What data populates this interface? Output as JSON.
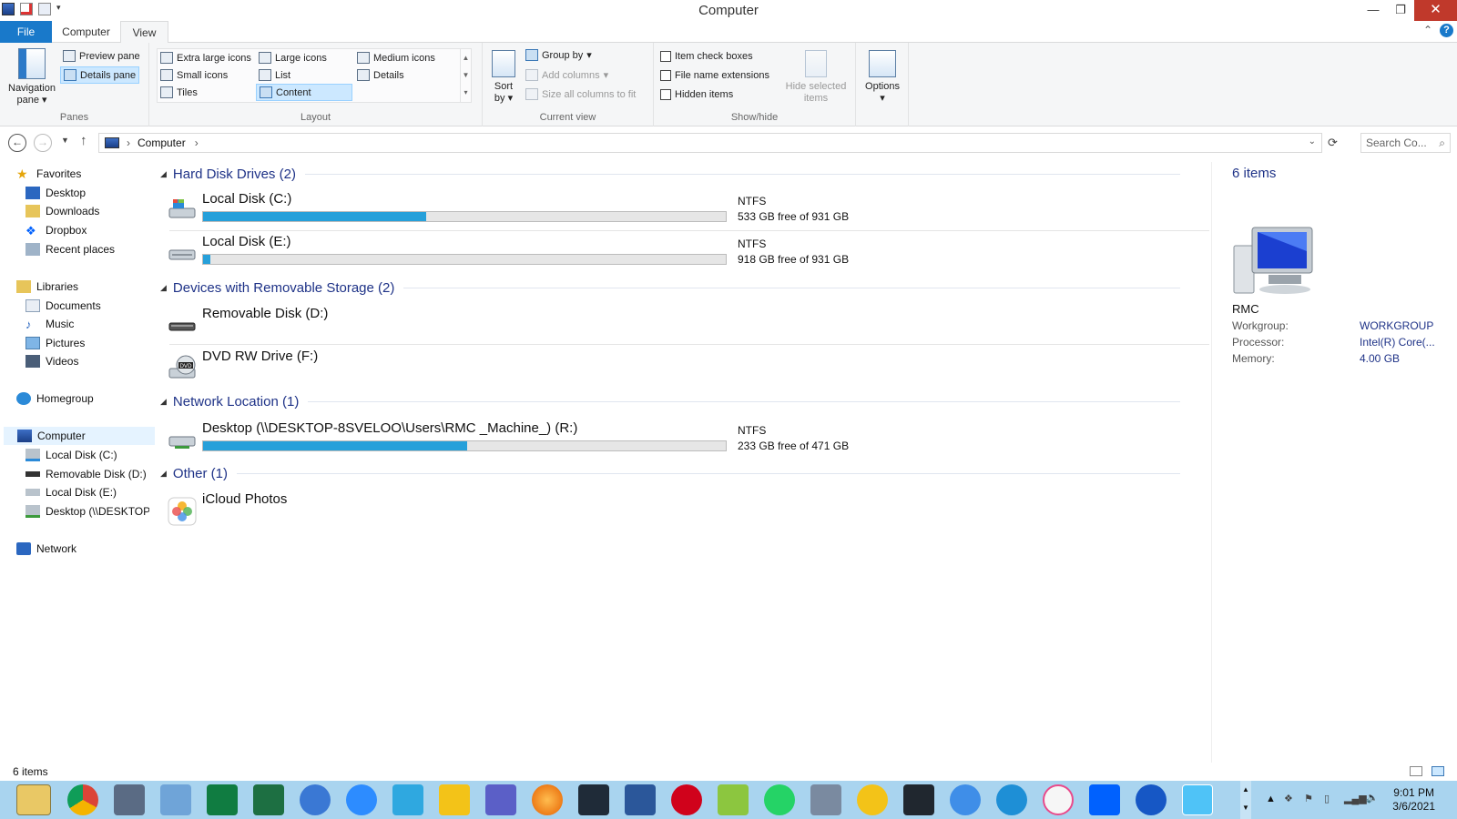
{
  "window": {
    "title": "Computer"
  },
  "ribbon_tabs": {
    "file": "File",
    "computer": "Computer",
    "view": "View"
  },
  "panes": {
    "nav_pane": "Navigation pane",
    "preview_pane": "Preview pane",
    "details_pane": "Details pane",
    "label": "Panes"
  },
  "layout": {
    "items": [
      "Extra large icons",
      "Large icons",
      "Medium icons",
      "Small icons",
      "List",
      "Details",
      "Tiles",
      "Content"
    ],
    "label": "Layout"
  },
  "current_view": {
    "sort_by": "Sort by",
    "group_by": "Group by",
    "add_columns": "Add columns",
    "size_columns": "Size all columns to fit",
    "label": "Current view"
  },
  "show_hide": {
    "item_check_boxes": "Item check boxes",
    "file_name_extensions": "File name extensions",
    "hidden_items": "Hidden items",
    "hide_selected": "Hide selected items",
    "label": "Show/hide"
  },
  "options": {
    "label": "Options"
  },
  "address": {
    "path": "Computer",
    "search_placeholder": "Search Co..."
  },
  "sidebar": {
    "favorites": "Favorites",
    "fav_items": [
      "Desktop",
      "Downloads",
      "Dropbox",
      "Recent places"
    ],
    "libraries": "Libraries",
    "lib_items": [
      "Documents",
      "Music",
      "Pictures",
      "Videos"
    ],
    "homegroup": "Homegroup",
    "computer": "Computer",
    "computer_items": [
      "Local Disk (C:)",
      "Removable Disk (D:)",
      "Local Disk (E:)",
      "Desktop (\\\\DESKTOP-"
    ],
    "network": "Network"
  },
  "groups": [
    {
      "name": "Hard Disk Drives (2)",
      "items": [
        {
          "name": "Local Disk (C:)",
          "fs": "NTFS",
          "free": "533 GB free of 931 GB",
          "used_fraction": 0.427
        },
        {
          "name": "Local Disk (E:)",
          "fs": "NTFS",
          "free": "918 GB free of 931 GB",
          "used_fraction": 0.014
        }
      ]
    },
    {
      "name": "Devices with Removable Storage (2)",
      "items": [
        {
          "name": "Removable Disk (D:)"
        },
        {
          "name": "DVD RW Drive (F:)"
        }
      ]
    },
    {
      "name": "Network Location (1)",
      "items": [
        {
          "name": "Desktop (\\\\DESKTOP-8SVELOO\\Users\\RMC _Machine_) (R:)",
          "fs": "NTFS",
          "free": "233 GB free of 471 GB",
          "used_fraction": 0.505
        }
      ]
    },
    {
      "name": "Other (1)",
      "items": [
        {
          "name": "iCloud Photos"
        }
      ]
    }
  ],
  "details": {
    "count": "6 items",
    "computer_name": "RMC",
    "rows": [
      {
        "label": "Workgroup:",
        "value": "WORKGROUP"
      },
      {
        "label": "Processor:",
        "value": "Intel(R) Core(..."
      },
      {
        "label": "Memory:",
        "value": "4.00 GB"
      }
    ]
  },
  "status": {
    "count": "6 items"
  },
  "taskbar": {
    "time": "9:01 PM",
    "date": "3/6/2021"
  },
  "colors": {
    "accent": "#1979ca",
    "bar_fill": "#26a0da",
    "group_header": "#1e3287",
    "taskbar": "#a9d4ef"
  }
}
